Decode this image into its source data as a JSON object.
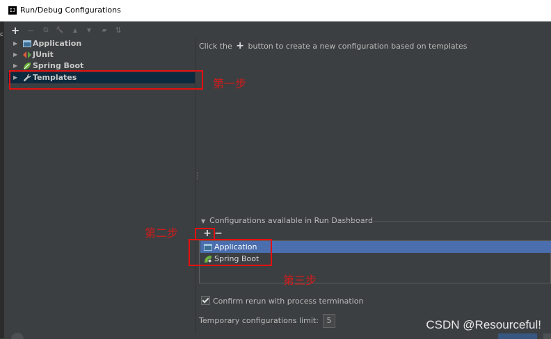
{
  "window": {
    "title": "Run/Debug Configurations",
    "app_icon_text": "IJ",
    "left_fragment": "c"
  },
  "toolbar": {
    "add": "+",
    "remove": "−",
    "copy": "⧉",
    "edit": "🔧",
    "up": "▲",
    "down": "▼",
    "folder": "▰",
    "sort": "⇅"
  },
  "tree": {
    "items": [
      {
        "label": "Application",
        "icon": "application-icon"
      },
      {
        "label": "JUnit",
        "icon": "junit-icon"
      },
      {
        "label": "Spring Boot",
        "icon": "spring-boot-icon"
      },
      {
        "label": "Templates",
        "icon": "wrench-icon"
      }
    ],
    "selected_index": 3
  },
  "hint": {
    "before": "Click the",
    "plus": "+",
    "after": "button to create a new configuration based on templates"
  },
  "dashboard": {
    "header": "Configurations available in Run Dashboard",
    "add": "+",
    "remove": "−",
    "items": [
      {
        "label": "Application"
      },
      {
        "label": "Spring Boot"
      }
    ],
    "selected_index": 0
  },
  "options": {
    "confirm_rerun_label": "Confirm rerun with process termination",
    "confirm_rerun_checked": true,
    "temp_limit_label": "Temporary configurations limit:",
    "temp_limit_value": "5"
  },
  "annotations": {
    "step1": "第一步",
    "step2": "第二步",
    "step3": "第三步"
  },
  "watermark": "CSDN @Resourceful!",
  "colors": {
    "annotation": "#e50f0f",
    "selection_tree": "#0d293e",
    "selection_list": "#4b6eaf",
    "background": "#3c3f41"
  }
}
